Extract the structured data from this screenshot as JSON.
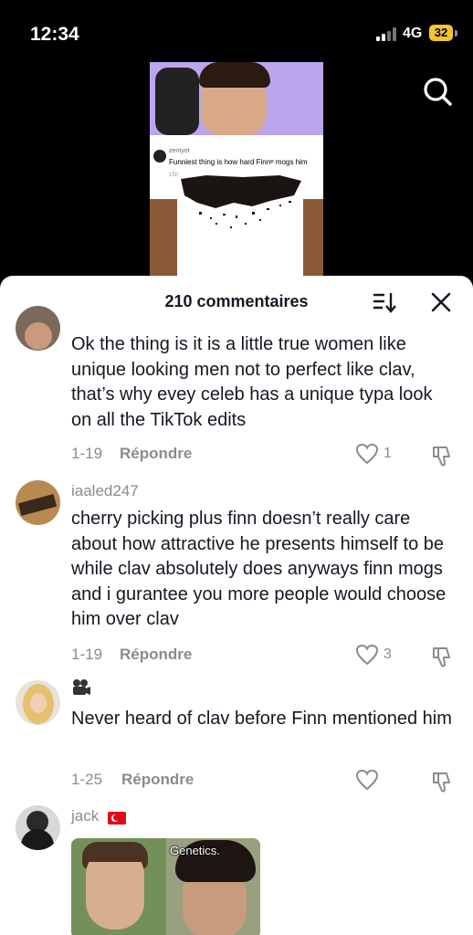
{
  "status_bar": {
    "time": "12:34",
    "network": "4G",
    "battery": "32",
    "battery_color": "#f2c530"
  },
  "video": {
    "overlay_user": "zentyot",
    "overlay_text": "Funniest thing is how hard Finnᵠ mogs him",
    "overlay_meta": "15h"
  },
  "comments_sheet": {
    "title": "210 commentaires",
    "sort_icon": "sort-list-icon",
    "close_icon": "close-icon"
  },
  "comments": [
    {
      "username": "",
      "text": "Ok the thing is it is a little true women like unique looking men not to perfect like clav, that’s why evey celeb has a unique typa look on all the TikTok edits",
      "date": "1-19",
      "reply_label": "Répondre",
      "likes": "1"
    },
    {
      "username": "iaaled247",
      "text": "cherry picking plus finn doesn’t really care about how attractive he presents himself to be while clav absolutely does anyways finn mogs and i gurantee you more people would choose him over clav",
      "date": "1-19",
      "reply_label": "Répondre",
      "likes": "3"
    },
    {
      "username": "",
      "username_icon": "movie-camera-icon",
      "text": "Never heard of clav before Finn mentioned him",
      "date": "1-25",
      "reply_label": "Répondre",
      "likes": ""
    },
    {
      "username": "jack",
      "username_icon": "turkey-flag-icon",
      "gif_caption": "Genetics."
    }
  ]
}
